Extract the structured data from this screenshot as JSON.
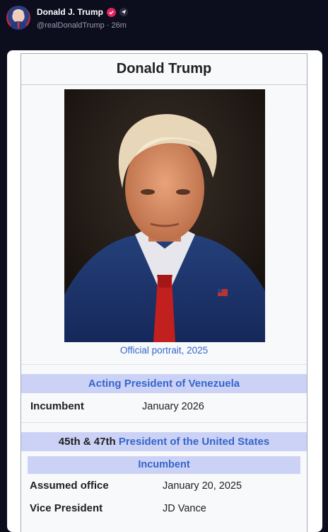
{
  "post": {
    "author_name": "Donald J. Trump",
    "handle": "@realDonaldTrump",
    "separator": "·",
    "time": "26m",
    "verified_icon": "verified-badge-icon",
    "plane_icon": "paper-plane-icon"
  },
  "infobox": {
    "title": "Donald Trump",
    "portrait_caption": "Official portrait, 2025",
    "section1": {
      "header": "Acting President of Venezuela",
      "row_label": "Incumbent",
      "row_value": "January 2026"
    },
    "section2": {
      "header_prefix": "45th & 47th",
      "header_link": "President of the United States",
      "subheader": "Incumbent",
      "rows": [
        {
          "label": "Assumed office",
          "value": "January 20, 2025"
        },
        {
          "label": "Vice President",
          "value": "JD Vance"
        }
      ]
    }
  },
  "colors": {
    "page_background": "#0c0d1d",
    "link": "#3366cc",
    "band": "#ccd2f5",
    "verified": "#e0245e"
  }
}
